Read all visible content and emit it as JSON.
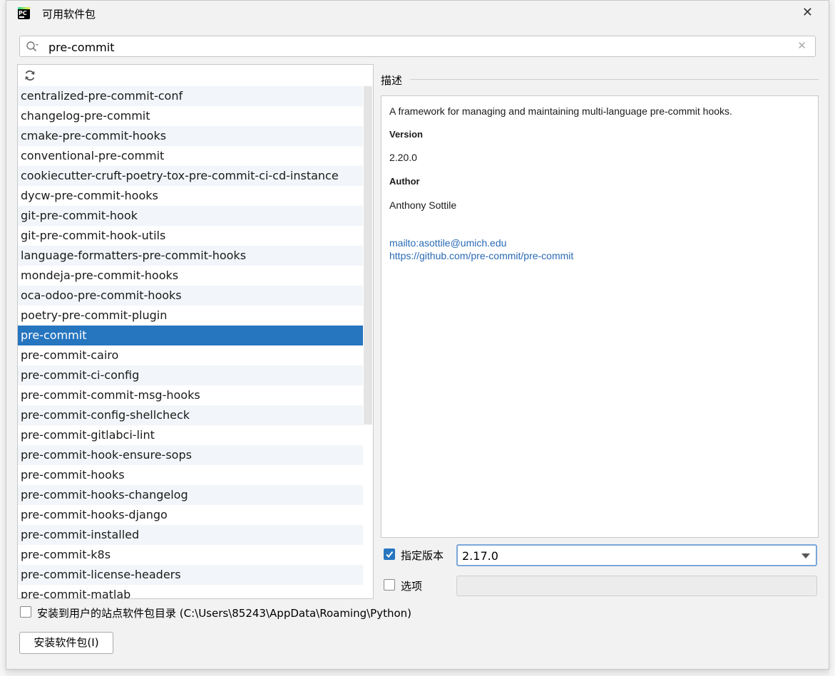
{
  "window": {
    "title": "可用软件包",
    "close_glyph": "✕"
  },
  "search": {
    "value": "pre-commit",
    "clear_glyph": "✕"
  },
  "packages": [
    "centralized-pre-commit-conf",
    "changelog-pre-commit",
    "cmake-pre-commit-hooks",
    "conventional-pre-commit",
    "cookiecutter-cruft-poetry-tox-pre-commit-ci-cd-instance",
    "dycw-pre-commit-hooks",
    "git-pre-commit-hook",
    "git-pre-commit-hook-utils",
    "language-formatters-pre-commit-hooks",
    "mondeja-pre-commit-hooks",
    "oca-odoo-pre-commit-hooks",
    "poetry-pre-commit-plugin",
    "pre-commit",
    "pre-commit-cairo",
    "pre-commit-ci-config",
    "pre-commit-commit-msg-hooks",
    "pre-commit-config-shellcheck",
    "pre-commit-gitlabci-lint",
    "pre-commit-hook-ensure-sops",
    "pre-commit-hooks",
    "pre-commit-hooks-changelog",
    "pre-commit-hooks-django",
    "pre-commit-installed",
    "pre-commit-k8s",
    "pre-commit-license-headers",
    "pre-commit-matlab"
  ],
  "selected_package": "pre-commit",
  "description": {
    "section_label": "描述",
    "text": "A framework for managing and maintaining multi-language pre-commit hooks.",
    "version_heading": "Version",
    "version_value": "2.20.0",
    "author_heading": "Author",
    "author_value": "Anthony Sottile",
    "link_email": "mailto:asottile@umich.edu",
    "link_repo": "https://github.com/pre-commit/pre-commit"
  },
  "specify_version": {
    "label": "指定版本",
    "checked": true,
    "selected_value": "2.17.0"
  },
  "options": {
    "label": "选项",
    "checked": false,
    "value": ""
  },
  "install_user_site": {
    "label": "安装到用户的站点软件包目录 (C:\\Users\\85243\\AppData\\Roaming\\Python)",
    "checked": false
  },
  "install_button": {
    "label": "安装软件包(I)"
  },
  "colors": {
    "selection": "#2675bf",
    "link": "#2a6ab5",
    "focus_border": "#7aa7d9"
  },
  "icons": {
    "app": "pycharm-icon",
    "search": "search-icon",
    "refresh": "refresh-icon",
    "dropdown": "chevron-down-icon"
  }
}
